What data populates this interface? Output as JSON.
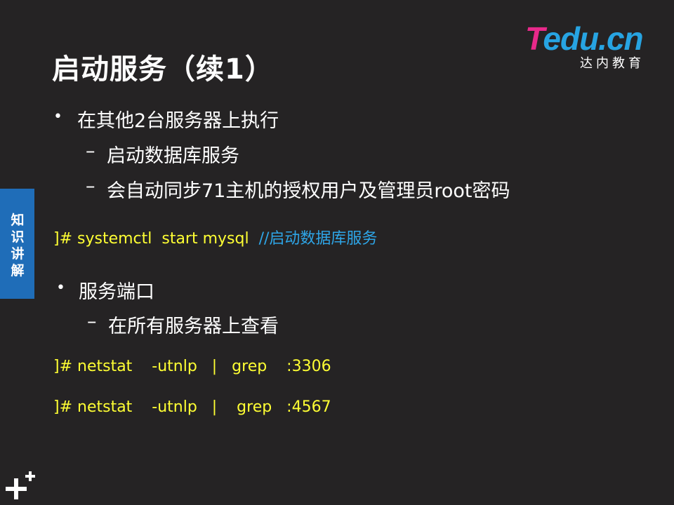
{
  "title": "启动服务（续1）",
  "logo": {
    "brand_t": "T",
    "brand_rest": "edu.cn",
    "subtitle": "达内教育"
  },
  "side_tab": {
    "chars": [
      "知",
      "识",
      "讲",
      "解"
    ]
  },
  "section1": {
    "bullet": "•",
    "text": "在其他2台服务器上执行",
    "items": [
      {
        "dash": "–",
        "text": "启动数据库服务"
      },
      {
        "dash": "–",
        "text": "会自动同步71主机的授权用户及管理员root密码"
      }
    ],
    "command": {
      "text": "]# systemctl  start mysql  ",
      "comment": "//启动数据库服务"
    }
  },
  "section2": {
    "bullet": "•",
    "text": "服务端口",
    "items": [
      {
        "dash": "–",
        "text": "在所有服务器上查看"
      }
    ],
    "commands": [
      "]# netstat    -utnlp   |   grep    :3306",
      "]# netstat    -utnlp   |    grep   :4567"
    ]
  },
  "colors": {
    "background": "#252324",
    "code": "#ffff33",
    "comment": "#2ea6e8",
    "tab": "#1f6db8"
  },
  "icons": {
    "corner": "plus-plus-icon"
  }
}
